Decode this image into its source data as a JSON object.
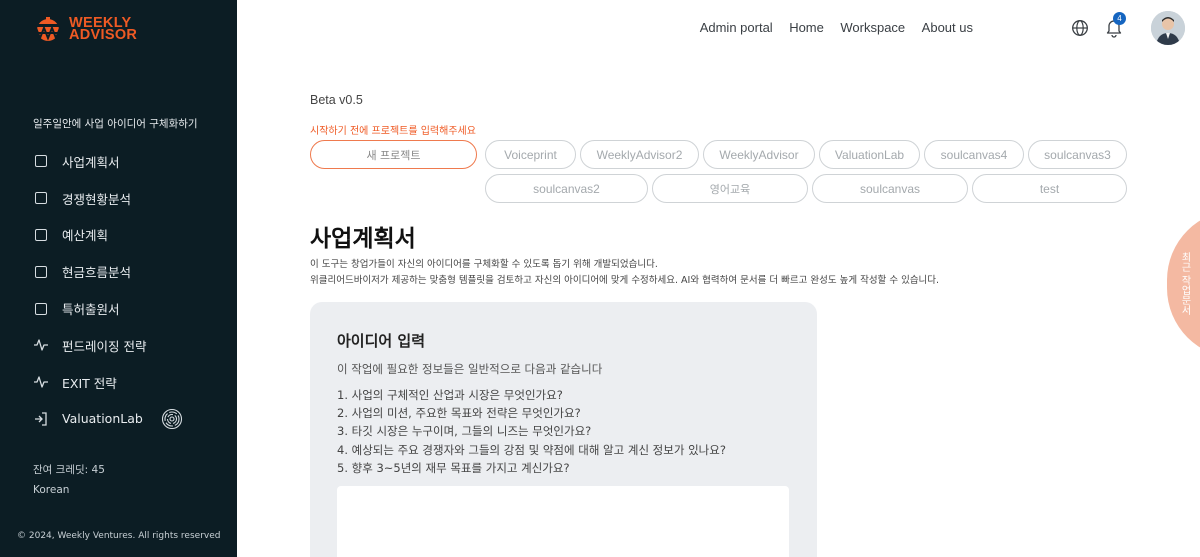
{
  "brand": {
    "line1": "WEEKLY",
    "line2": "ADVISOR",
    "color": "#ef5a24"
  },
  "sidebar": {
    "section_title": "일주일안에 사업 아이디어 구체화하기",
    "items": [
      {
        "label": "사업계획서",
        "icon": "checkbox-icon"
      },
      {
        "label": "경쟁현황분석",
        "icon": "checkbox-icon"
      },
      {
        "label": "예산계획",
        "icon": "checkbox-icon"
      },
      {
        "label": "현금흐름분석",
        "icon": "checkbox-icon"
      },
      {
        "label": "특허출원서",
        "icon": "checkbox-icon"
      },
      {
        "label": "펀드레이징 전략",
        "icon": "activity-icon"
      },
      {
        "label": "EXIT 전략",
        "icon": "activity-icon"
      },
      {
        "label": "ValuationLab",
        "icon": "login-icon"
      }
    ],
    "credits": "잔여 크레딧: 45",
    "language": "Korean",
    "copyright": "© 2024, Weekly Ventures. All rights reserved"
  },
  "topnav": {
    "links": [
      "Admin portal",
      "Home",
      "Workspace",
      "About us"
    ],
    "notification_count": "4"
  },
  "main": {
    "version": "Beta v0.5",
    "warning": "시작하기 전에 프로젝트를 입력해주세요",
    "new_project": "새 프로젝트",
    "projects": [
      "Voiceprint",
      "WeeklyAdvisor2",
      "WeeklyAdvisor",
      "ValuationLab",
      "soulcanvas4",
      "soulcanvas3",
      "soulcanvas2",
      "영어교육",
      "soulcanvas",
      "test"
    ],
    "title": "사업계획서",
    "desc1": "이 도구는 창업가들이 자신의 아이디어를 구체화할 수 있도록 돕기 위해 개발되었습니다.",
    "desc2": "위클리어드바이저가 제공하는 맞춤형 템플릿을 검토하고 자신의 아이디어에 맞게 수정하세요. AI와 협력하여 문서를 더 빠르고 완성도 높게 작성할 수 있습니다.",
    "card": {
      "title": "아이디어 입력",
      "subtitle": "이 작업에 필요한 정보들은 일반적으로 다음과 같습니다",
      "questions": [
        "1. 사업의 구체적인 산업과 시장은 무엇인가요?",
        "2. 사업의 미션, 주요한 목표와 전략은 무엇인가요?",
        "3. 타깃 시장은 누구이며, 그들의 니즈는 무엇인가요?",
        "4. 예상되는 주요 경쟁자와 그들의 강점 및 약점에 대해 알고 계신 정보가 있나요?",
        "5. 향후 3~5년의 재무 목표를 가지고 계신가요?"
      ]
    },
    "side_tab": "최근 작업문서"
  }
}
